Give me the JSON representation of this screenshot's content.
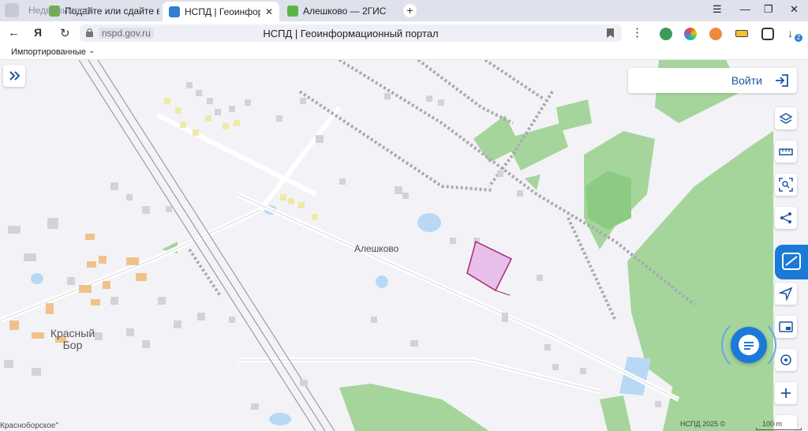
{
  "browser": {
    "tabs": [
      {
        "label": "Подайте или сдайте в а",
        "active": false,
        "color": "#6db33f"
      },
      {
        "label": "НСПД | Геоинформацио",
        "active": true,
        "color": "#2d7fd0"
      },
      {
        "label": "Алешково — 2ГИС",
        "active": false,
        "color": "#5bb544"
      }
    ],
    "overlay_text": "Недвижимость",
    "url": "nspd.gov.ru",
    "page_title": "НСПД | Геоинформационный портал",
    "bookmarks_folder": "Импортированные",
    "downloads_count": "2"
  },
  "map": {
    "login_label": "Войти",
    "village_label": "Алешково",
    "town_label_1": "Красный",
    "town_label_2": "Бор",
    "bottom_label": "Красноборское\"",
    "copyright": "НСПД 2025 ©",
    "scale": "100 m",
    "colors": {
      "forest": "#a5d59b",
      "water": "#b8d8f5",
      "parcel_fill": "#e6c0e8",
      "parcel_stroke": "#a8287c",
      "accent": "#1b7ad8"
    },
    "tools": [
      "layers-icon",
      "ruler-icon",
      "select-area-icon",
      "share-icon",
      "locate-icon",
      "minimap-icon",
      "geolocation-icon",
      "zoom-in-icon"
    ]
  }
}
